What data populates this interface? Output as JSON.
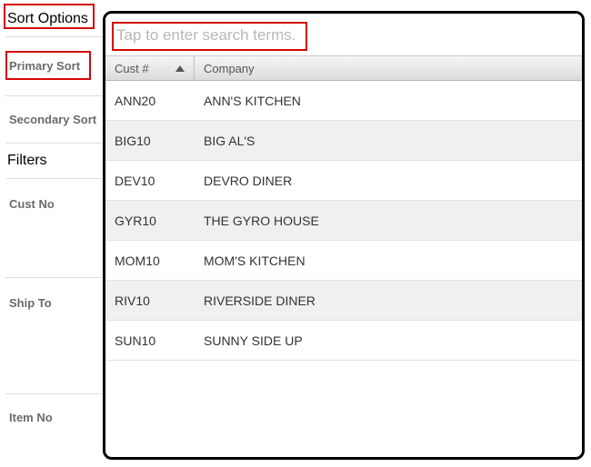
{
  "sidebar": {
    "sort_options_header": "Sort Options",
    "primary_sort_label": "Primary Sort",
    "secondary_sort_label": "Secondary Sort",
    "filters_header": "Filters",
    "filter_cust_no": "Cust No",
    "filter_ship_to": "Ship To",
    "filter_item_no": "Item No"
  },
  "popup": {
    "search_placeholder": "Tap to enter search terms.",
    "columns": {
      "cust": "Cust #",
      "company": "Company"
    },
    "sort_direction": "asc",
    "rows": [
      {
        "cust": "ANN20",
        "company": "ANN'S KITCHEN"
      },
      {
        "cust": "BIG10",
        "company": "BIG AL'S"
      },
      {
        "cust": "DEV10",
        "company": "DEVRO DINER"
      },
      {
        "cust": "GYR10",
        "company": "THE GYRO HOUSE"
      },
      {
        "cust": "MOM10",
        "company": "MOM'S KITCHEN"
      },
      {
        "cust": "RIV10",
        "company": "RIVERSIDE DINER"
      },
      {
        "cust": "SUN10",
        "company": "SUNNY SIDE UP"
      }
    ]
  }
}
